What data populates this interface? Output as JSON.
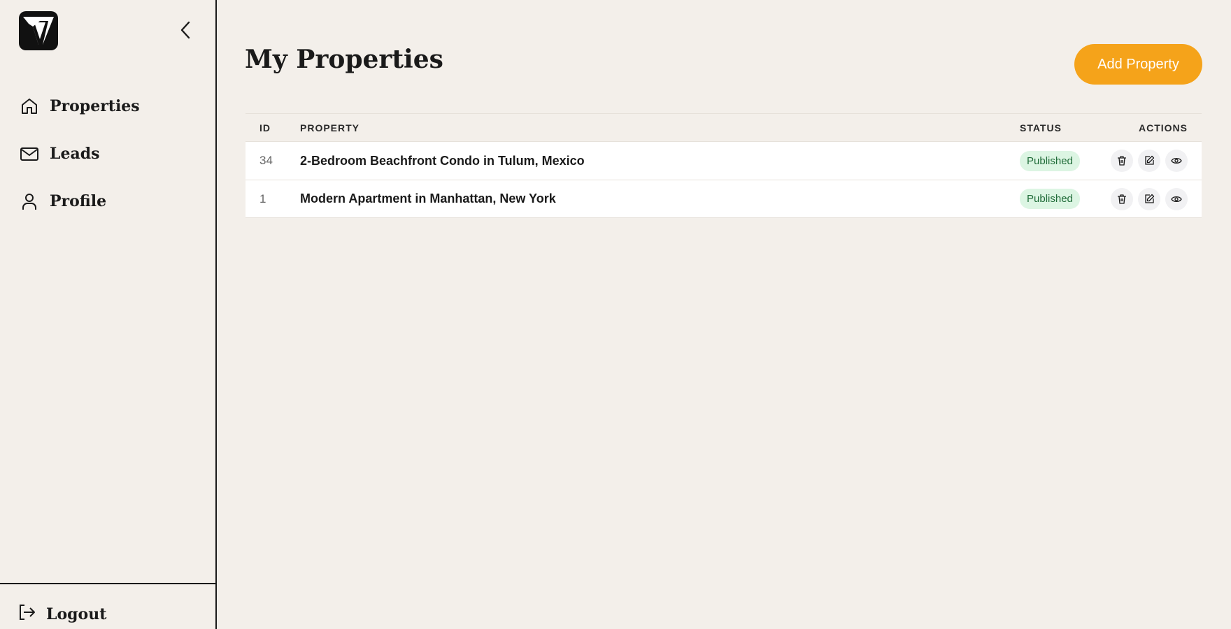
{
  "sidebar": {
    "logo_icon": "v-logo-icon",
    "collapse_icon": "chevron-left-icon",
    "items": [
      {
        "label": "Properties",
        "icon": "home-icon"
      },
      {
        "label": "Leads",
        "icon": "mail-icon"
      },
      {
        "label": "Profile",
        "icon": "user-icon"
      }
    ],
    "logout": {
      "label": "Logout",
      "icon": "logout-icon"
    }
  },
  "main": {
    "title": "My Properties",
    "add_button_label": "Add Property",
    "colors": {
      "accent": "#f5a31a",
      "badge_bg": "#dcf5e3",
      "badge_text": "#1f6b38",
      "background": "#f3efea"
    },
    "table": {
      "headers": {
        "id": "ID",
        "property": "PROPERTY",
        "status": "STATUS",
        "actions": "ACTIONS"
      },
      "rows": [
        {
          "id": "34",
          "property": "2-Bedroom Beachfront Condo in Tulum, Mexico",
          "status": "Published"
        },
        {
          "id": "1",
          "property": "Modern Apartment in Manhattan, New York",
          "status": "Published"
        }
      ],
      "action_icons": [
        "trash-icon",
        "edit-icon",
        "eye-icon"
      ]
    }
  }
}
